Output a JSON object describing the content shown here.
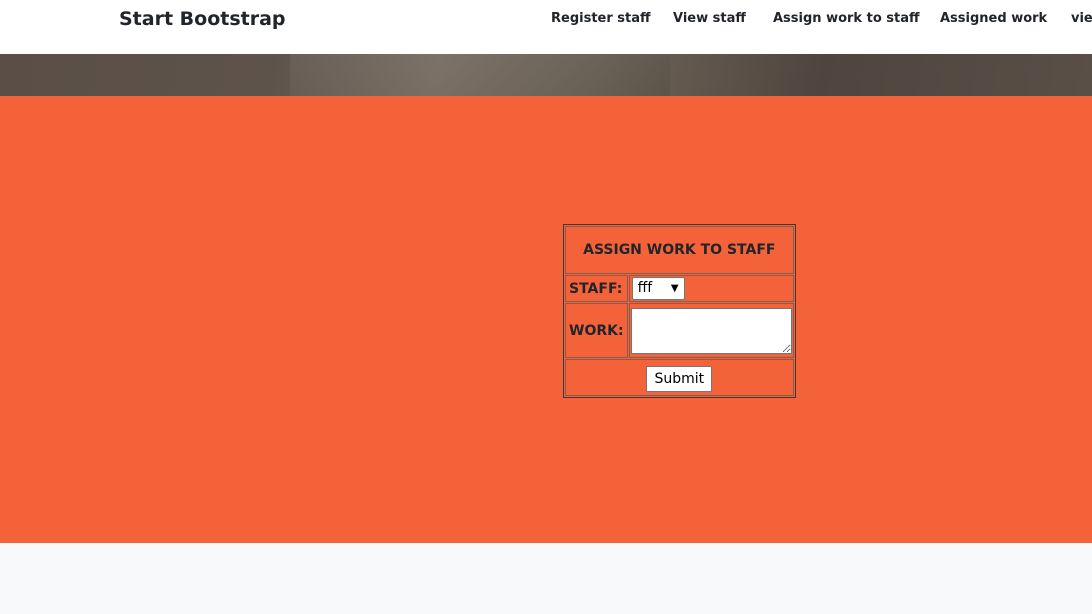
{
  "navbar": {
    "brand": "Start Bootstrap",
    "links": [
      "Register staff",
      "View staff",
      "Assign work to staff",
      "Assigned work",
      "view"
    ]
  },
  "form": {
    "title": "ASSIGN WORK TO STAFF",
    "staff_label": "STAFF:",
    "staff_selected": "fff",
    "work_label": "WORK:",
    "work_value": "",
    "submit_label": "Submit"
  },
  "colors": {
    "masthead": "#f4623a",
    "navbar": "#ffffff",
    "footer": "#f8f9fa"
  }
}
